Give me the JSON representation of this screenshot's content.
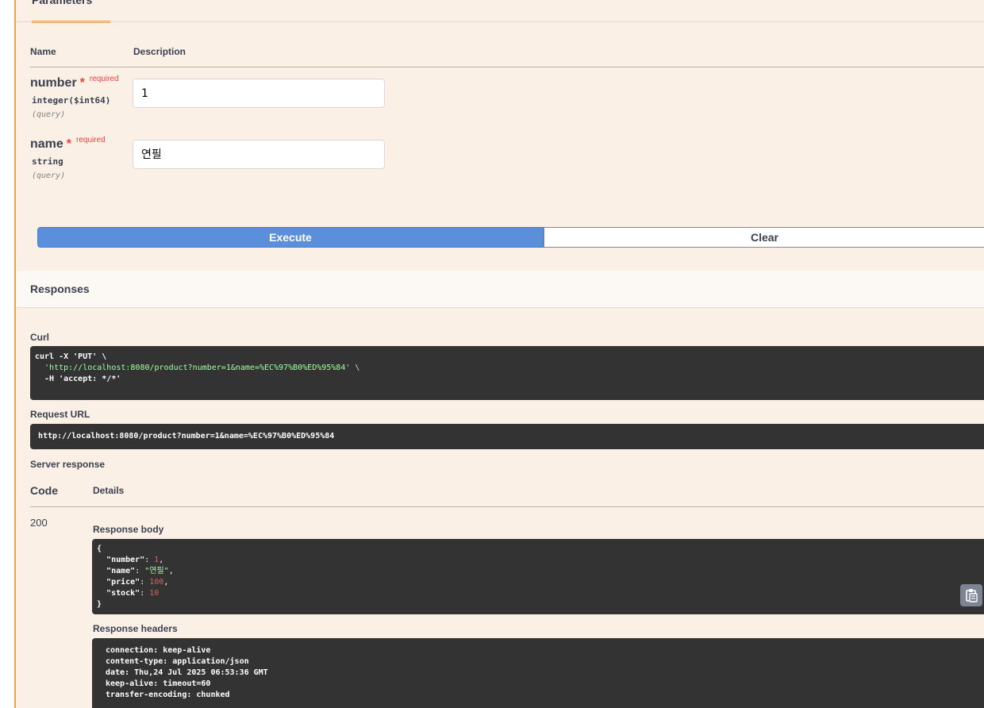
{
  "parameters": {
    "tab_label": "Parameters",
    "col_name": "Name",
    "col_description": "Description",
    "required_star": "*",
    "required_label": "required",
    "items": [
      {
        "name": "number",
        "type": "integer($int64)",
        "in": "(query)",
        "value": "1"
      },
      {
        "name": "name",
        "type": "string",
        "in": "(query)",
        "value": "연필"
      }
    ]
  },
  "actions": {
    "execute_label": "Execute",
    "clear_label": "Clear"
  },
  "responses": {
    "title": "Responses",
    "curl_label": "Curl",
    "curl_lines": [
      "curl -X 'PUT' \\",
      "  'http://localhost:8080/product?number=1&name=%EC%97%B0%ED%95%84' \\",
      "  -H 'accept: */*'"
    ],
    "request_url_label": "Request URL",
    "request_url": "http://localhost:8080/product?number=1&name=%EC%97%B0%ED%95%84",
    "server_response_label": "Server response",
    "col_code": "Code",
    "col_details": "Details",
    "status_code": "200",
    "body_label": "Response body",
    "body": {
      "number": 1,
      "name": "연필",
      "price": 100,
      "stock": 10
    },
    "headers_label": "Response headers",
    "headers": [
      "connection: keep-alive",
      "content-type: application/json",
      "date: Thu,24 Jul 2025 06:53:36 GMT",
      "keep-alive: timeout=60",
      "transfer-encoding: chunked"
    ]
  },
  "colors": {
    "accent": "#f0a04b",
    "execute": "#5b8fdb",
    "panel_bg": "#faf0e6",
    "code_bg": "#333333"
  }
}
